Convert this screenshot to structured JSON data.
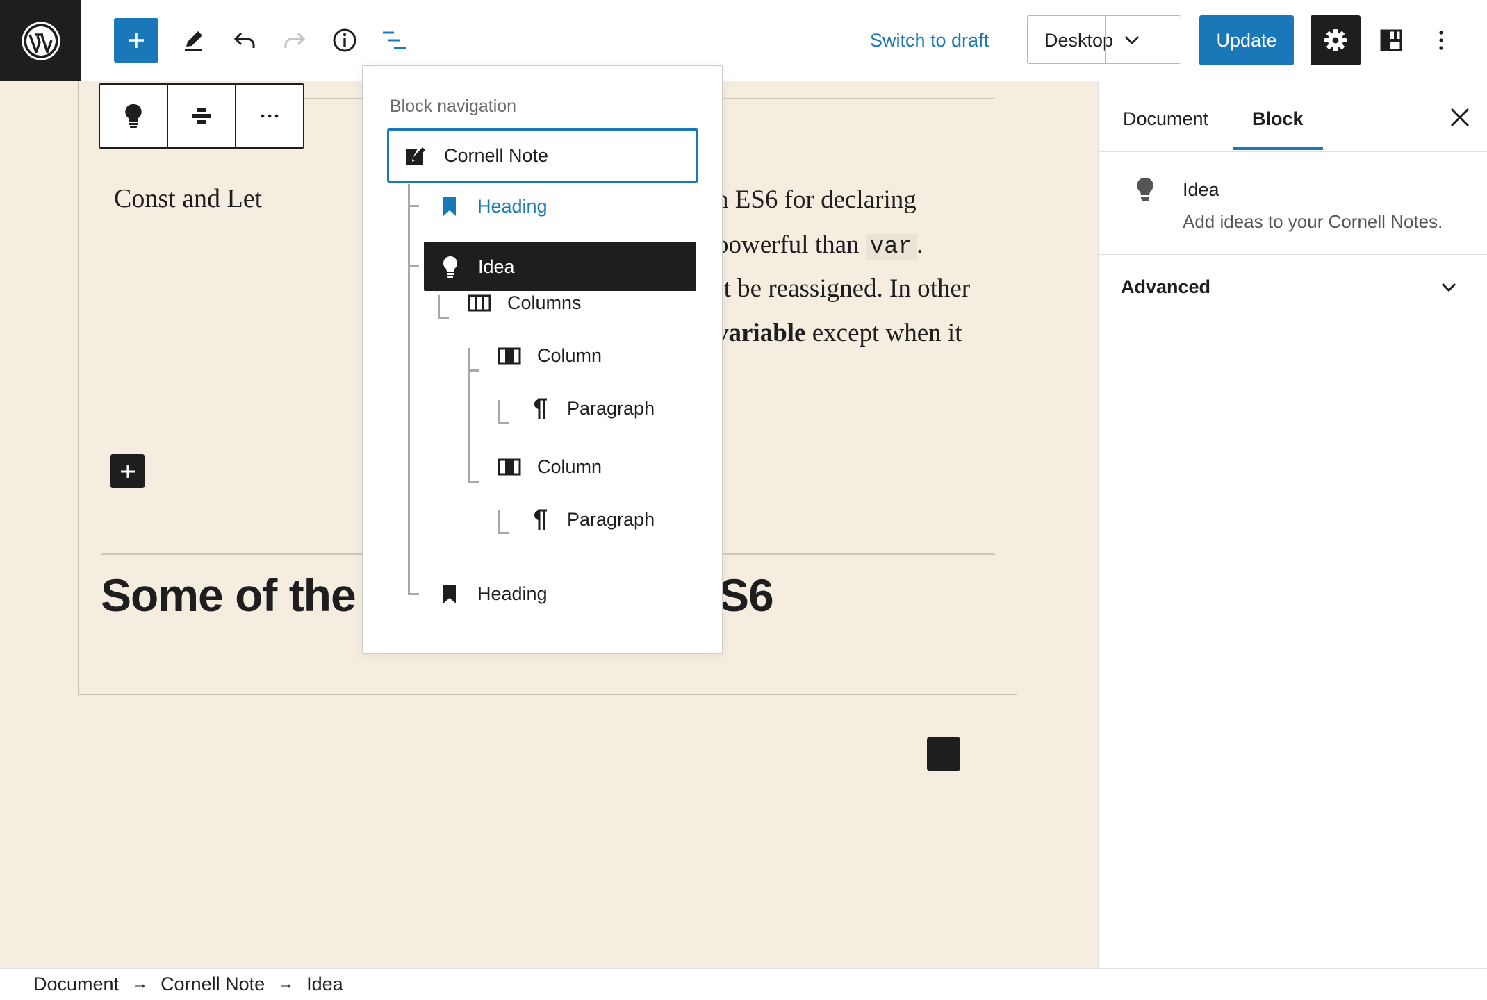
{
  "header": {
    "add_label": "+",
    "switch_to_draft": "Switch to draft",
    "device_preview": "Desktop",
    "update_label": "Update",
    "icons": [
      "wordpress-logo",
      "plus-icon",
      "pencil-icon",
      "undo-icon",
      "redo-icon",
      "info-icon",
      "list-view-icon",
      "chevron-down-icon",
      "gear-icon",
      "layout-icon",
      "more-vertical-icon"
    ]
  },
  "canvas": {
    "cue": "Const and Let",
    "note_lines": [
      {
        "text": "n ES6 for declaring"
      },
      {
        "pre": "powerful than ",
        "code": "var",
        "post": "."
      },
      {
        "text": "’t be reassigned. In other"
      },
      {
        "bold": "variable",
        "post": " except when it"
      }
    ],
    "heading_left": "Some of the common features of ES6",
    "heading_right": "S6"
  },
  "block_navigation": {
    "title": "Block navigation",
    "items": [
      {
        "label": "Cornell Note",
        "icon": "edit-block-icon",
        "state": "root"
      },
      {
        "label": "Heading",
        "icon": "bookmark-icon",
        "state": "link"
      },
      {
        "label": "Idea",
        "icon": "lightbulb-icon",
        "state": "selected"
      },
      {
        "label": "Columns",
        "icon": "columns-icon",
        "state": "normal"
      },
      {
        "label": "Column",
        "icon": "column-icon",
        "state": "normal"
      },
      {
        "label": "Paragraph",
        "icon": "paragraph-icon",
        "state": "normal"
      },
      {
        "label": "Column",
        "icon": "column-icon",
        "state": "normal"
      },
      {
        "label": "Paragraph",
        "icon": "paragraph-icon",
        "state": "normal"
      },
      {
        "label": "Heading",
        "icon": "bookmark-icon",
        "state": "normal"
      }
    ]
  },
  "sidebar": {
    "tabs": [
      "Document",
      "Block"
    ],
    "active_tab": "Block",
    "block_card": {
      "title": "Idea",
      "description": "Add ideas to your Cornell Notes."
    },
    "advanced_label": "Advanced"
  },
  "breadcrumb": [
    "Document",
    "Cornell Note",
    "Idea"
  ],
  "colors": {
    "accent": "#1b78b8",
    "canvas_bg": "#f4ede0",
    "dark": "#1e1e1e"
  }
}
